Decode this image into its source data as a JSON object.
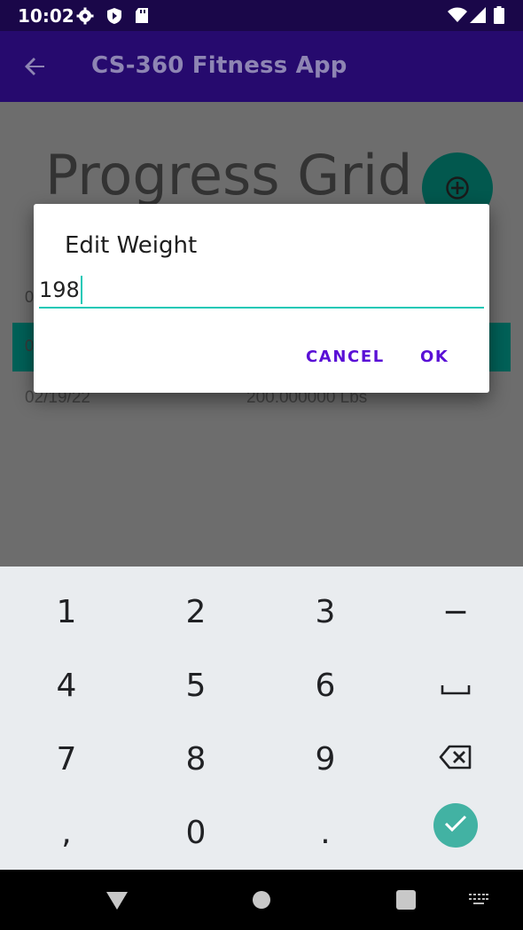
{
  "status_bar": {
    "time": "10:02",
    "icons": [
      "settings-icon",
      "shield-icon",
      "sd-card-icon",
      "wifi-icon",
      "cell-signal-icon",
      "battery-icon"
    ]
  },
  "app_bar": {
    "title": "CS-360 Fitness App",
    "back_icon": "arrow-back-icon"
  },
  "background": {
    "grid_title": "Progress Grid",
    "fab_icon": "add-circle-icon",
    "row_fragment_1": "0",
    "row_fragment_2": "0",
    "rows": [
      {
        "date": "02/19/22",
        "weight": "200.000000 Lbs"
      }
    ]
  },
  "dialog": {
    "title": "Edit Weight",
    "input_value": "198",
    "cancel_label": "CANCEL",
    "ok_label": "OK"
  },
  "keyboard": {
    "keys": [
      "1",
      "2",
      "3",
      "−",
      "4",
      "5",
      "6",
      "",
      "7",
      "8",
      "9",
      "",
      ",",
      "0",
      ".",
      ""
    ],
    "special_icons": [
      "space-icon",
      "backspace-icon",
      "done-check-icon"
    ]
  },
  "nav_bar": {
    "icons": [
      "back-triangle-icon",
      "home-circle-icon",
      "recents-square-icon",
      "keyboard-switch-icon"
    ]
  },
  "colors": {
    "app_bar": "#260a6e",
    "accent": "#17c8b6",
    "button_text": "#5a10d6",
    "fab": "#02584e",
    "done_key": "#42b2a3"
  }
}
